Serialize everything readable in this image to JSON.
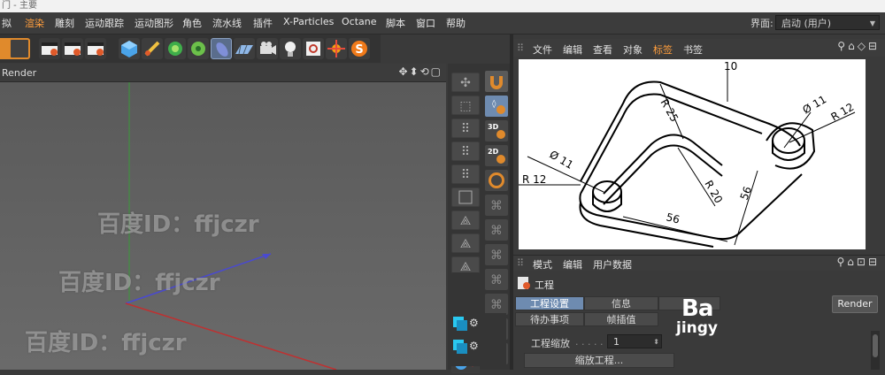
{
  "window": {
    "title": "门 - 主要"
  },
  "menu": [
    "拟",
    "渲染",
    "雕刻",
    "运动跟踪",
    "运动图形",
    "角色",
    "流水线",
    "插件",
    "X-Particles",
    "Octane",
    "脚本",
    "窗口",
    "帮助"
  ],
  "layout": {
    "label": "界面:",
    "value": "启动 (用户)"
  },
  "viewport": {
    "title": "Render",
    "icons": "✥⬍⟲▢"
  },
  "watermarks": [
    "百度ID：ffjczr",
    "百度ID：ffjczr",
    "百度ID：ffjczr"
  ],
  "object_manager": {
    "menu": [
      "文件",
      "编辑",
      "查看",
      "对象",
      "标签",
      "书签"
    ],
    "icons": "⚲⌂◇⊟"
  },
  "drawing": {
    "labels": [
      "10",
      "R 25",
      "Ø 11",
      "R 12",
      "Ø 11",
      "R 12",
      "R 20",
      "56",
      "56"
    ]
  },
  "attributes": {
    "menu": [
      "模式",
      "编辑",
      "用户数据"
    ],
    "icons": "⚲⌂⊡⊟",
    "title": "工程",
    "tabs": [
      "工程设置",
      "信息",
      "",
      "待办事项",
      "帧插值"
    ],
    "field_label": "工程缩放",
    "field_value": "1",
    "scale_button": "缩放工程...",
    "render_button": "Render"
  },
  "baidu": {
    "line1": "Ba",
    "line2": "jingy"
  },
  "colors": {
    "accent": "#ff9e3d",
    "tab_active": "#6e8bb0"
  }
}
